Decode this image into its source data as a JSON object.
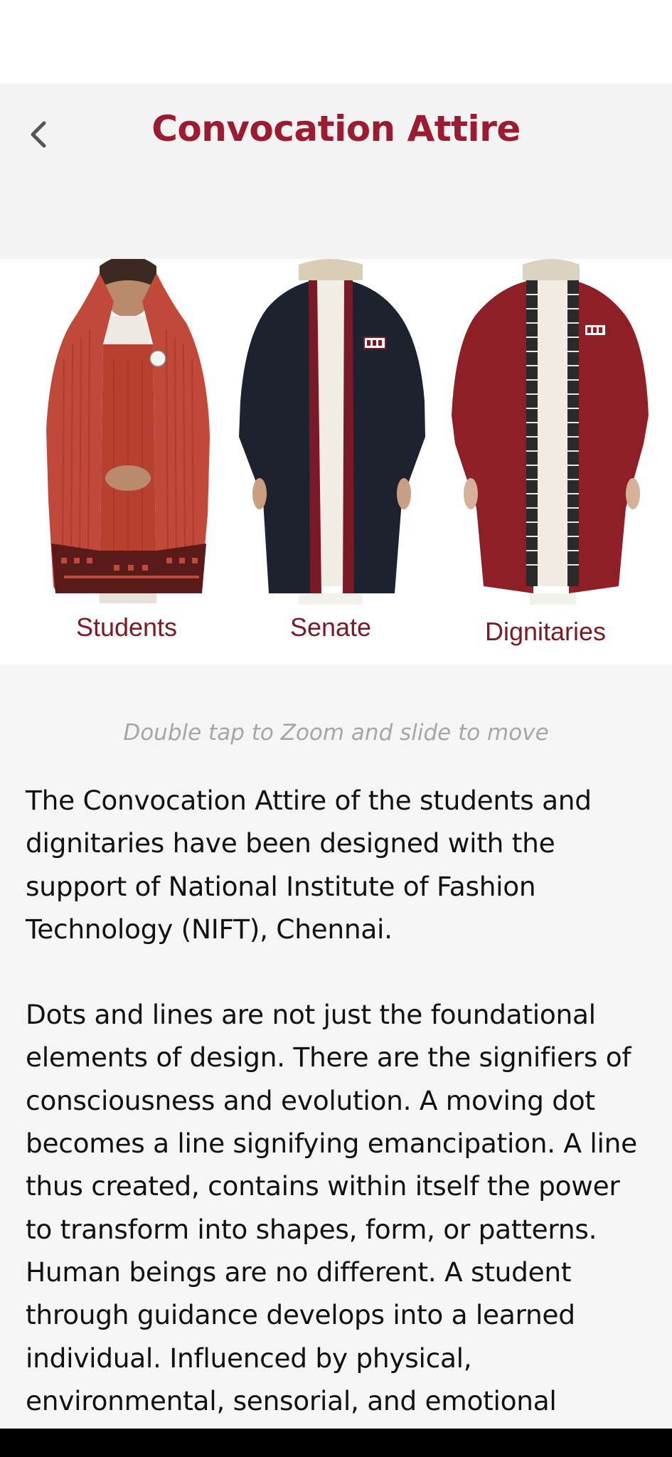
{
  "header": {
    "title": "Convocation Attire",
    "back_icon": "chevron-left-icon"
  },
  "hero": {
    "captions": [
      "Students",
      "Senate",
      "Dignitaries"
    ],
    "colors": {
      "students_robe": "#c1493a",
      "senate_robe": "#1d222e",
      "dignitaries_robe": "#8e1f26"
    }
  },
  "hint": "Double tap to Zoom and slide to move",
  "body": {
    "paragraphs": [
      "The Convocation Attire of the students and dignitaries have been designed with the support of National Institute of Fashion Technology (NIFT), Chennai.",
      "Dots and lines are not just the foundational elements of design. There are the signifiers of consciousness and evolution. A moving dot becomes a line signifying emancipation. A line thus created, contains within itself the power to transform into shapes, form, or patterns. Human beings are no different. A student through guidance develops into a learned individual. Influenced by physical, environmental, sensorial, and emotional"
    ]
  },
  "theme": {
    "accent": "#9b1b30"
  }
}
